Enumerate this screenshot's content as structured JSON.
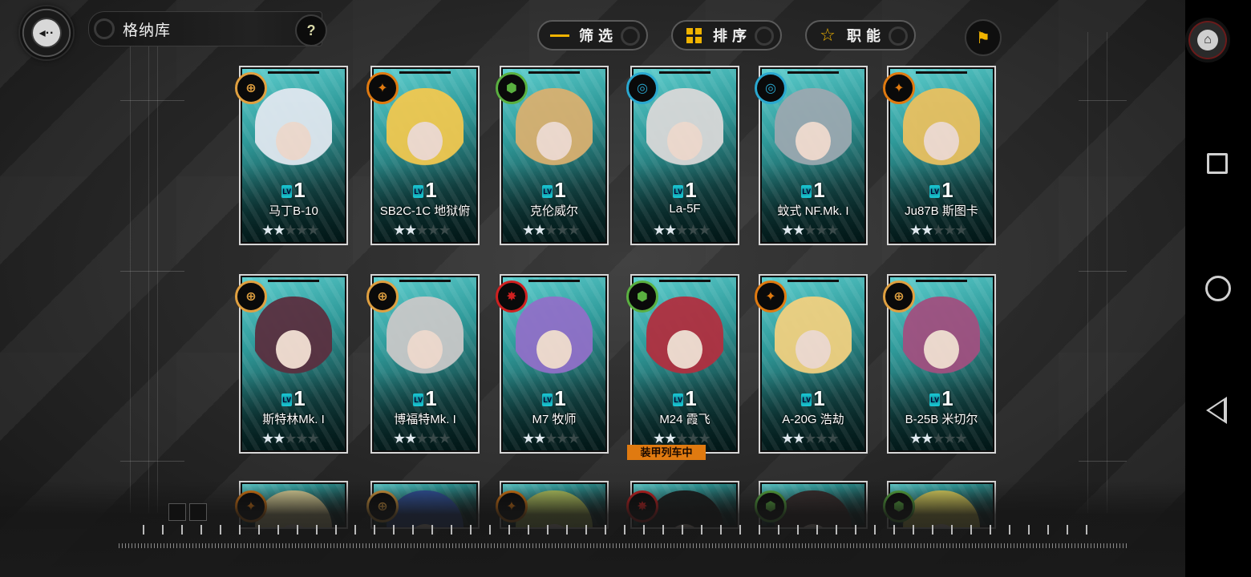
{
  "header": {
    "title": "格纳库",
    "help_label": "?",
    "filter_label": "筛选",
    "sort_label": "排序",
    "role_label": "职能"
  },
  "colors": {
    "accent": "#f0b300",
    "card_bg": "#2f9a9a",
    "status_tag": "#e07a10",
    "level_tag": "#19c3d0"
  },
  "cards": [
    {
      "name": "马丁B-10",
      "level": "1",
      "lv_tag": "LV",
      "stars": "★★",
      "stars_off": "★★★",
      "badge_icon": "bomber-icon",
      "badge_color": "#e0a040"
    },
    {
      "name": "SB2C-1C 地狱俯",
      "level": "1",
      "lv_tag": "LV",
      "stars": "★★",
      "stars_off": "★★★",
      "badge_icon": "dive-bomber-icon",
      "badge_color": "#e07a10"
    },
    {
      "name": "克伦威尔",
      "level": "1",
      "lv_tag": "LV",
      "stars": "★★",
      "stars_off": "★★★",
      "badge_icon": "tank-icon",
      "badge_color": "#5ab040"
    },
    {
      "name": "La-5F",
      "level": "1",
      "lv_tag": "LV",
      "stars": "★★",
      "stars_off": "★★★",
      "badge_icon": "fighter-icon",
      "badge_color": "#2aa8d0"
    },
    {
      "name": "蚊式 NF.Mk. I",
      "level": "1",
      "lv_tag": "LV",
      "stars": "★★",
      "stars_off": "★★★",
      "badge_icon": "fighter-icon",
      "badge_color": "#2aa8d0"
    },
    {
      "name": "Ju87B 斯图卡",
      "level": "1",
      "lv_tag": "LV",
      "stars": "★★",
      "stars_off": "★★★",
      "badge_icon": "dive-bomber-icon",
      "badge_color": "#e07a10"
    },
    {
      "name": "斯特林Mk. I",
      "level": "1",
      "lv_tag": "LV",
      "stars": "★★",
      "stars_off": "★★★",
      "badge_icon": "bomber-icon",
      "badge_color": "#e0a040"
    },
    {
      "name": "博福特Mk. I",
      "level": "1",
      "lv_tag": "LV",
      "stars": "★★",
      "stars_off": "★★★",
      "badge_icon": "bomber-icon",
      "badge_color": "#e0a040"
    },
    {
      "name": "M7 牧师",
      "level": "1",
      "lv_tag": "LV",
      "stars": "★★",
      "stars_off": "★★★",
      "badge_icon": "artillery-icon",
      "badge_color": "#d02020"
    },
    {
      "name": "M24 霞飞",
      "level": "1",
      "lv_tag": "LV",
      "stars": "★★",
      "stars_off": "★★★",
      "badge_icon": "tank-icon",
      "badge_color": "#5ab040",
      "status": "装甲列车中"
    },
    {
      "name": "A-20G 浩劫",
      "level": "1",
      "lv_tag": "LV",
      "stars": "★★",
      "stars_off": "★★★",
      "badge_icon": "dive-bomber-icon",
      "badge_color": "#e07a10"
    },
    {
      "name": "B-25B 米切尔",
      "level": "1",
      "lv_tag": "LV",
      "stars": "★★",
      "stars_off": "★★★",
      "badge_icon": "bomber-icon",
      "badge_color": "#e0a040"
    }
  ],
  "partial_row_badges": [
    {
      "badge_icon": "dive-bomber-icon",
      "badge_color": "#e07a10"
    },
    {
      "badge_icon": "bomber-icon",
      "badge_color": "#e0a040"
    },
    {
      "badge_icon": "dive-bomber-icon",
      "badge_color": "#e07a10"
    },
    {
      "badge_icon": "artillery-icon",
      "badge_color": "#d02020"
    },
    {
      "badge_icon": "tank-icon",
      "badge_color": "#5ab040"
    },
    {
      "badge_icon": "tank-icon",
      "badge_color": "#5ab040"
    }
  ]
}
